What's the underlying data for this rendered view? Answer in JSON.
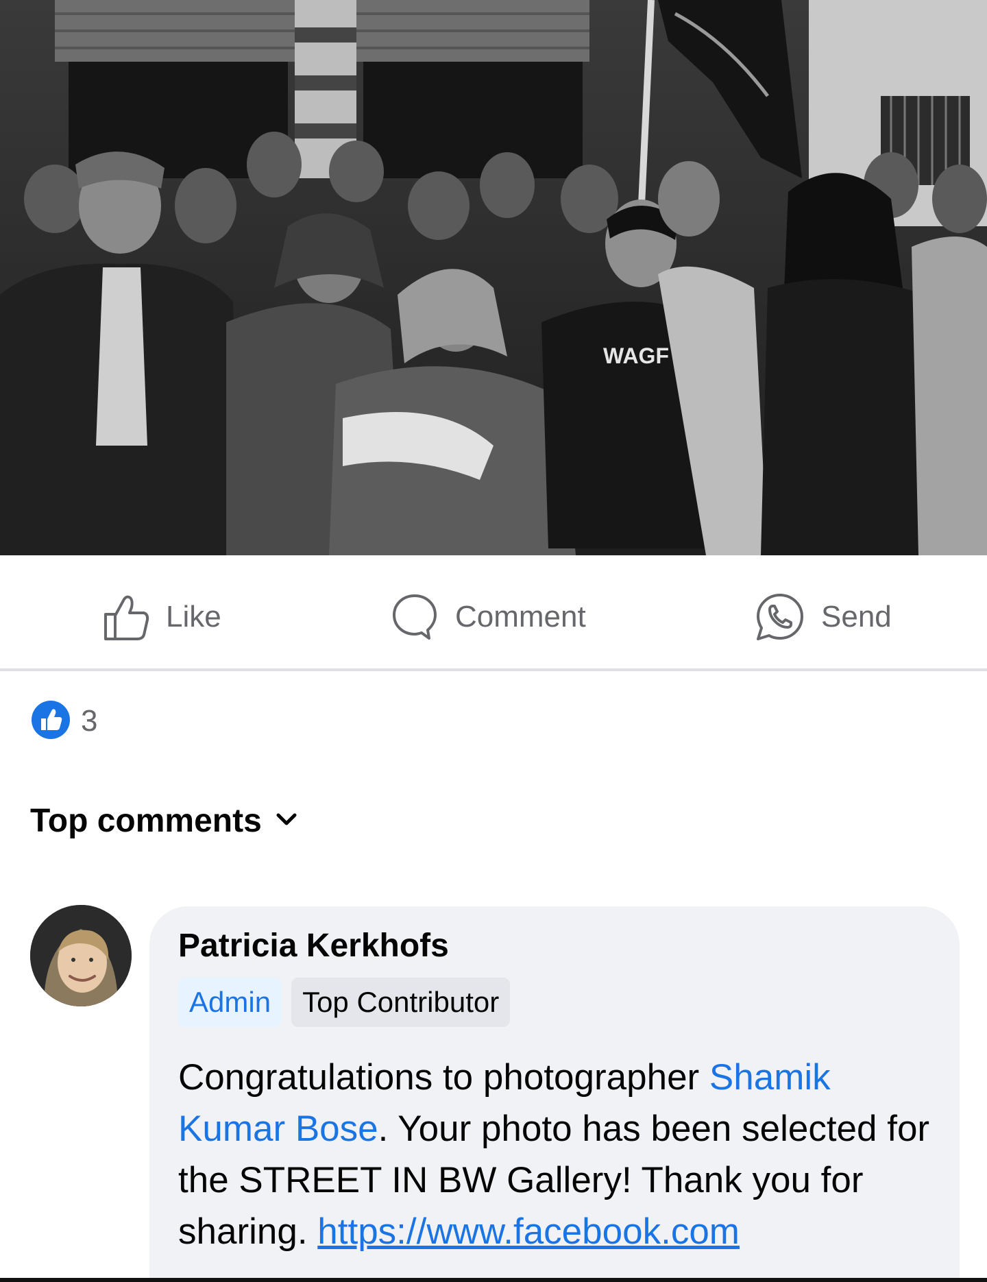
{
  "post": {
    "photo_icon": "black-and-white-street-crowd-photo"
  },
  "actions": {
    "like_label": "Like",
    "comment_label": "Comment",
    "send_label": "Send",
    "like_icon": "thumbs-up-icon",
    "comment_icon": "speech-bubble-icon",
    "send_icon": "whatsapp-icon"
  },
  "reactions": {
    "icon": "like-reaction-icon",
    "count": "3",
    "color": "#1b74e4"
  },
  "comments": {
    "sort_label": "Top comments",
    "sort_icon": "chevron-down-icon",
    "items": [
      {
        "author": "Patricia Kerkhofs",
        "badges": [
          "Admin",
          "Top Contributor"
        ],
        "text_before": "Congratulations to photographer ",
        "mention": "Shamik Kumar Bose",
        "text_after": ".  Your photo has been selected for the STREET IN BW Gallery! Thank you for sharing. ",
        "link": "https://www.facebook.com"
      }
    ]
  },
  "colors": {
    "accent": "#1b74e4",
    "secondary_text": "#65676b",
    "bubble": "#f0f2f5"
  }
}
